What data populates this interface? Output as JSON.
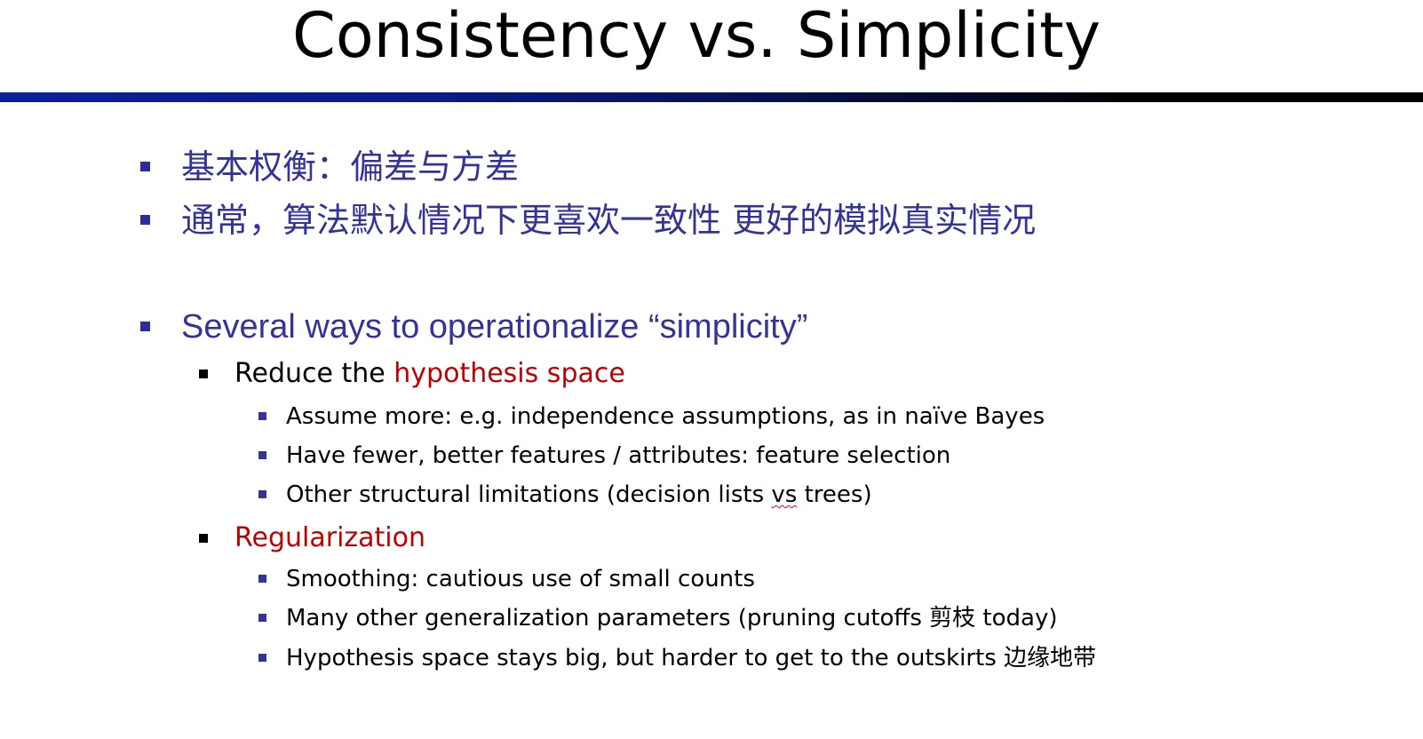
{
  "title": "Consistency vs. Simplicity",
  "colors": {
    "level1_text": "#33339a",
    "highlight_red": "#c00000",
    "rule_blue": "#0a1fa0",
    "rule_dark": "#000000"
  },
  "bullets": {
    "b1": "基本权衡：偏差与方差",
    "b2": "通常，算法默认情况下更喜欢一致性 更好的模拟真实情况",
    "b3": "Several ways to operationalize “simplicity”",
    "b3_1_prefix": "Reduce the ",
    "b3_1_highlight": "hypothesis space",
    "b3_1_1": "Assume more: e.g. independence assumptions, as in naïve Bayes",
    "b3_1_2": "Have fewer, better features / attributes: feature selection",
    "b3_1_3_pre": "Other structural limitations (decision lists ",
    "b3_1_3_vs": "vs",
    "b3_1_3_post": " trees)",
    "b3_2": "Regularization",
    "b3_2_1": "Smoothing: cautious use of small counts",
    "b3_2_2": "Many other generalization parameters (pruning cutoffs 剪枝 today)",
    "b3_2_3": "Hypothesis space stays big, but harder to get to the outskirts 边缘地带"
  }
}
